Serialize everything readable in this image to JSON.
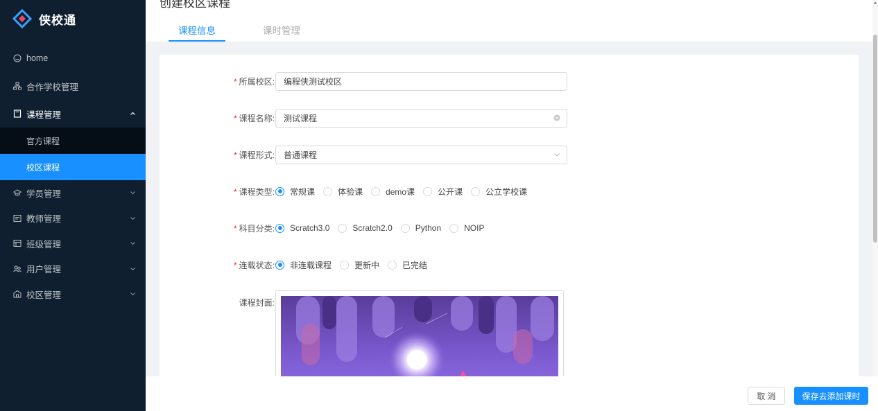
{
  "app": {
    "name": "侠校通"
  },
  "page": {
    "title": "创建校区课程"
  },
  "sidebar": {
    "items": [
      {
        "label": "home",
        "icon": "smile-icon"
      },
      {
        "label": "合作学校管理",
        "icon": "apartment-icon"
      },
      {
        "label": "课程管理",
        "icon": "book-icon",
        "sub": [
          {
            "label": "官方课程"
          },
          {
            "label": "校区课程",
            "active": true
          }
        ]
      },
      {
        "label": "学员管理",
        "icon": "student-icon"
      },
      {
        "label": "教师管理",
        "icon": "teacher-icon"
      },
      {
        "label": "班级管理",
        "icon": "class-icon"
      },
      {
        "label": "用户管理",
        "icon": "users-icon"
      },
      {
        "label": "校区管理",
        "icon": "campus-icon"
      }
    ]
  },
  "tabs": [
    {
      "label": "课程信息",
      "active": true
    },
    {
      "label": "课时管理",
      "active": false
    }
  ],
  "form": {
    "campus": {
      "label": "所属校区:",
      "value": "编程侠测试校区"
    },
    "course_name": {
      "label": "课程名称:",
      "value": "测试课程"
    },
    "course_form": {
      "label": "课程形式:",
      "value": "普通课程"
    },
    "course_type": {
      "label": "课程类型:",
      "options": [
        "常规课",
        "体验课",
        "demo课",
        "公开课",
        "公立学校课"
      ],
      "selected": 0
    },
    "subject": {
      "label": "科目分类:",
      "options": [
        "Scratch3.0",
        "Scratch2.0",
        "Python",
        "NOIP"
      ],
      "selected": 0
    },
    "serial_status": {
      "label": "连载状态:",
      "options": [
        "非连载课程",
        "更新中",
        "已完结"
      ],
      "selected": 0
    },
    "cover": {
      "label": "课程封面:"
    }
  },
  "footer": {
    "cancel": "取 消",
    "save": "保存去添加课时"
  },
  "colors": {
    "primary": "#1890ff",
    "sidebar_bg": "#0f1f2f",
    "required": "#f5222d"
  }
}
